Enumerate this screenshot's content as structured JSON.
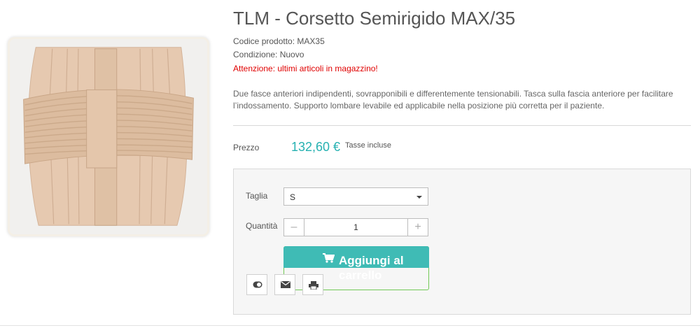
{
  "product": {
    "title": "TLM - Corsetto Semirigido MAX/35",
    "code": "Codice prodotto: MAX35",
    "condition": "Condizione: Nuovo",
    "warning": "Attenzione: ultimi articoli in magazzino!",
    "description": "Due fasce anteriori indipendenti, sovrapponibili e differentemente tensionabili. Tasca sulla fascia anteriore per facilitare l’indossamento. Supporto lombare levabile ed applicabile nella posizione più corretta per il paziente."
  },
  "pricing": {
    "label": "Prezzo",
    "value": "132,60 €",
    "tax_note": "Tasse incluse"
  },
  "options": {
    "size_label": "Taglia",
    "size_value": "S",
    "quantity_label": "Quantità",
    "quantity_value": "1",
    "minus_symbol": "–",
    "plus_symbol": "+"
  },
  "cart": {
    "add_label": "Aggiungi al carrello"
  },
  "icons": {
    "cart": "cart-icon",
    "toggle": "toggle-icon",
    "email": "envelope-icon",
    "print": "printer-icon",
    "caret": "chevron-down-icon"
  },
  "colors": {
    "accent": "#3fbbb5",
    "price": "#26b1b1",
    "warning": "#e00000",
    "button_outline": "#72c957"
  }
}
